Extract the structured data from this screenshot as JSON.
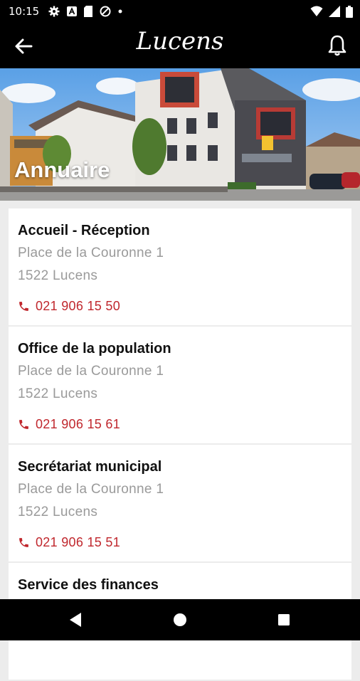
{
  "status_bar": {
    "time": "10:15"
  },
  "app_bar": {
    "logo_text": "Lucens"
  },
  "hero": {
    "title": "Annuaire"
  },
  "entries": [
    {
      "name": "Accueil - Réception",
      "address_line1": "Place de la Couronne 1",
      "address_line2": "1522 Lucens",
      "phone": "021 906 15 50"
    },
    {
      "name": "Office de la population",
      "address_line1": "Place de la Couronne 1",
      "address_line2": "1522 Lucens",
      "phone": "021 906 15 61"
    },
    {
      "name": "Secrétariat municipal",
      "address_line1": "Place de la Couronne 1",
      "address_line2": "1522 Lucens",
      "phone": "021 906 15 51"
    },
    {
      "name": "Service des finances"
    }
  ],
  "colors": {
    "accent": "#c0272d",
    "bar": "#000000",
    "background": "#ececec"
  }
}
